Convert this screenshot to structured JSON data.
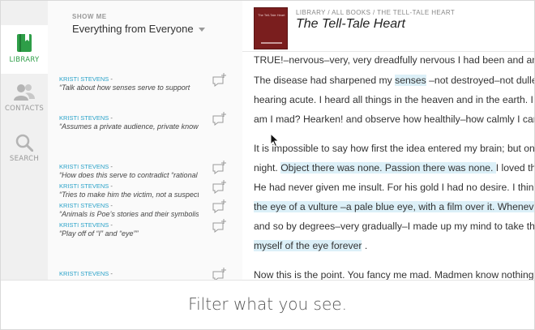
{
  "colors": {
    "accent": "#2aa2c9",
    "active_nav": "#2e9e48",
    "highlight": "#dcf0f8",
    "cover": "#7a1e1e"
  },
  "nav": {
    "items": [
      {
        "label": "LIBRARY",
        "icon": "book-icon",
        "active": true
      },
      {
        "label": "CONTACTS",
        "icon": "people-icon",
        "active": false
      },
      {
        "label": "SEARCH",
        "icon": "search-icon",
        "active": false
      }
    ]
  },
  "filter": {
    "caption": "SHOW ME",
    "value": "Everything from Everyone"
  },
  "annotations": [
    {
      "author": "KRISTI STEVENS",
      "quote": "“Talk about how senses serve to support"
    },
    {
      "author": "KRISTI STEVENS",
      "quote": "“Assumes a private audience, private know"
    },
    {
      "author": "KRISTI STEVENS",
      "quote": "“How does this serve to contradict “rational"
    },
    {
      "author": "KRISTI STEVENS",
      "quote": "“Tries to make him the victim, not a suspect"
    },
    {
      "author": "KRISTI STEVENS",
      "quote": "“Animals is Poe’s stories and their symbolism"
    },
    {
      "author": "KRISTI STEVENS",
      "quote": "“Play off of “I” and “eye””"
    },
    {
      "author": "KRISTI STEVENS",
      "quote": ""
    }
  ],
  "book": {
    "breadcrumb": "LIBRARY / ALL BOOKS / THE TELL-TALE HEART",
    "title": "The Tell-Tale Heart",
    "cover_text": "The Tell-Tale Heart",
    "lines": [
      [
        {
          "t": "TRUE!–nervous–very, very dreadfully nervous I had been and am; but why will you say that I am mad?"
        }
      ],
      [
        {
          "t": "The disease had sharpened my "
        },
        {
          "t": "senses",
          "h": true
        },
        {
          "t": " –not destroyed–not dulled them. Above all was the sense of"
        }
      ],
      [
        {
          "t": "hearing acute. I heard all things in the heaven and in the earth. I heard many things in hell. How, then,"
        }
      ],
      [
        {
          "t": "am I mad? Hearken! and observe how healthily–how calmly I can tell you the whole story."
        }
      ],
      [
        {
          "t": "It is impossible to say how first the idea entered my brain; but once conceived, it haunted me day and"
        }
      ],
      [
        {
          "t": "night. "
        },
        {
          "t": "Object there was none. Passion there was none. ",
          "h": true
        },
        {
          "t": " I loved the old man. He had never wronged me."
        }
      ],
      [
        {
          "t": "He had never given me insult. For his gold I had no desire. I think it was his eye! yes, it was this! He had"
        }
      ],
      [
        {
          "t": "the eye of a vulture –a pale blue eye, with a film over it. Whenever it fell upon me, my blood ran cold;",
          "h": true
        }
      ],
      [
        {
          "t": "and so by degrees–very gradually–I made up my mind to take the life of the old man, and thus rid"
        }
      ],
      [
        {
          "t": "myself of the eye forever",
          "h": true
        },
        {
          "t": " ."
        }
      ],
      [
        {
          "t": "Now this is the point. You fancy me mad. Madmen know nothing. But you should have seen me."
        }
      ]
    ]
  },
  "caption": "Filter what you see."
}
